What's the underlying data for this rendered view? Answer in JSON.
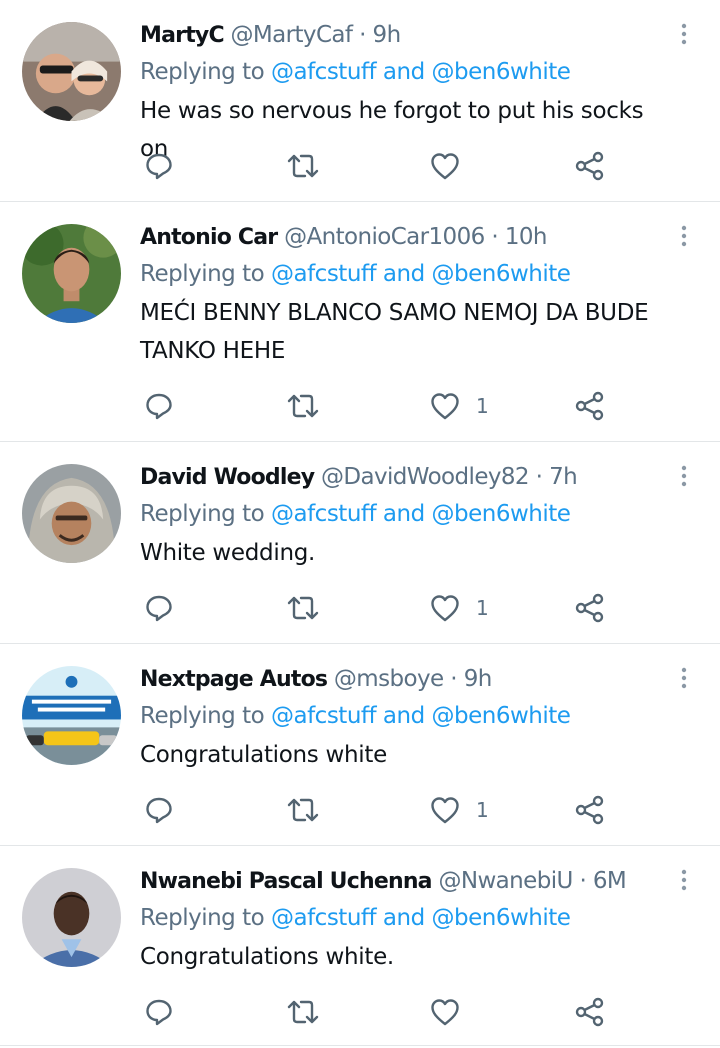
{
  "reply_prefix": "Replying to",
  "mention_join": "and",
  "tweets": [
    {
      "name": "MartyC",
      "handle": "@MartyCaf",
      "dot": "·",
      "time": "9h",
      "mention1": "@afcstuff",
      "mention2": "@ben6white",
      "text": "He was so nervous he forgot to put his socks on",
      "like_count": ""
    },
    {
      "name": "Antonio Car",
      "handle": "@AntonioCar1006",
      "dot": "·",
      "time": "10h",
      "mention1": "@afcstuff",
      "mention2": "@ben6white",
      "text": "MEĆI BENNY BLANCO SAMO NEMOJ DA BUDE TANKO HEHE",
      "like_count": "1"
    },
    {
      "name": "David Woodley",
      "handle": "@DavidWoodley82",
      "dot": "·",
      "time": "7h",
      "mention1": "@afcstuff",
      "mention2": "@ben6white",
      "text": "White wedding.",
      "like_count": "1"
    },
    {
      "name": "Nextpage Autos",
      "handle": "@msboye",
      "dot": "·",
      "time": "9h",
      "mention1": "@afcstuff",
      "mention2": "@ben6white",
      "text": "Congratulations white",
      "like_count": "1"
    },
    {
      "name": "Nwanebi Pascal Uchenna",
      "handle": "@NwanebiU",
      "dot": "·",
      "time": "6M",
      "mention1": "@afcstuff",
      "mention2": "@ben6white",
      "text": "Congratulations white.",
      "like_count": ""
    }
  ],
  "colors": {
    "mention": "#1d9bf0",
    "secondary": "#5b7083",
    "icon": "#536471",
    "divider": "#e3e6e8"
  },
  "icons": [
    "reply-icon",
    "retweet-icon",
    "like-icon",
    "share-icon",
    "more-options-icon"
  ]
}
